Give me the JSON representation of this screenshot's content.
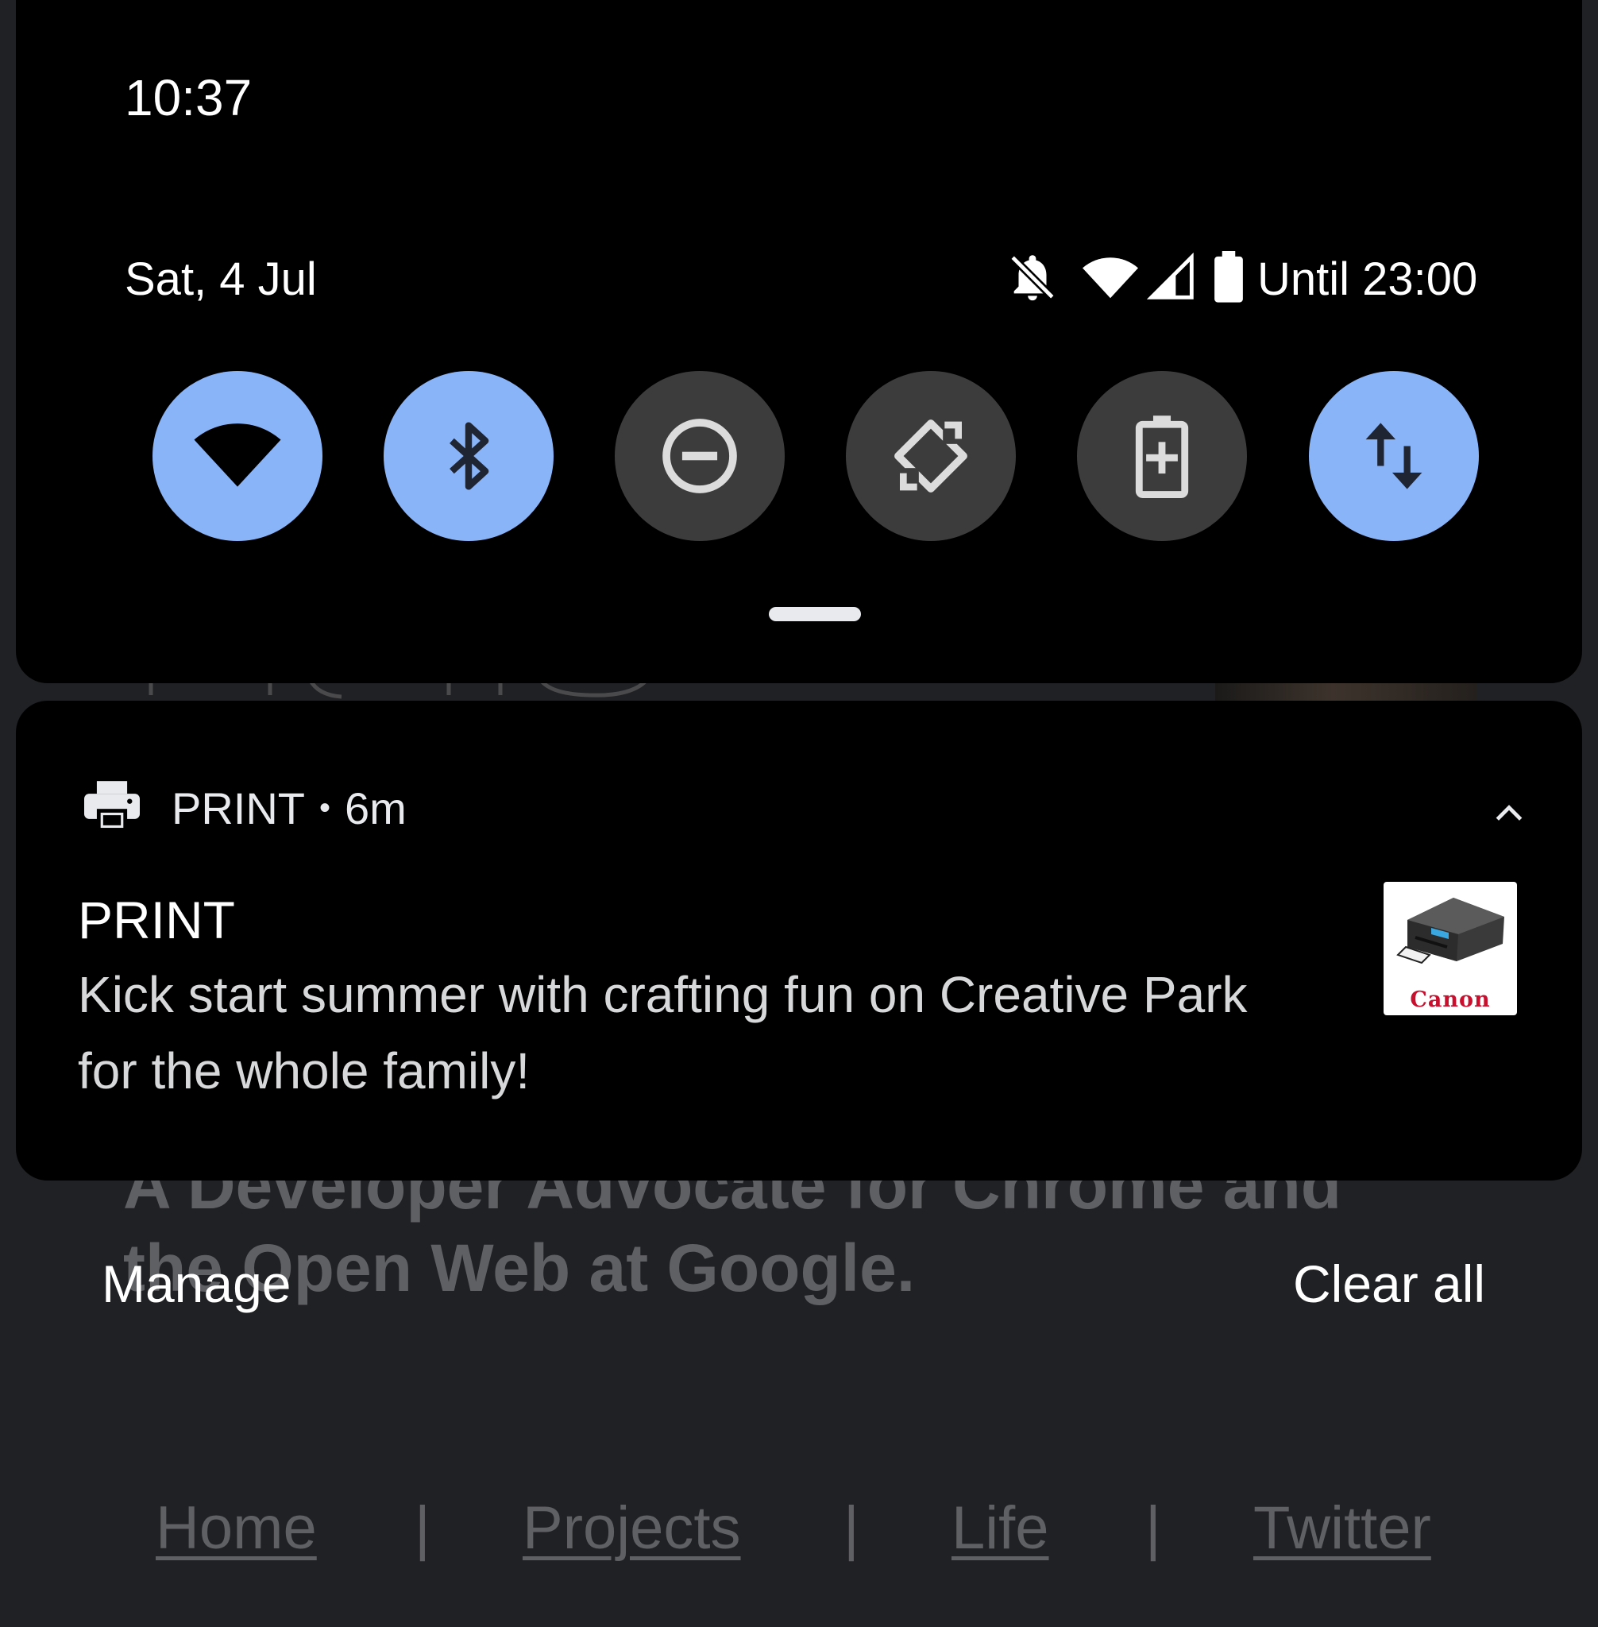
{
  "background_page": {
    "description_lines": [
      "A Developer Advocate for Chrome and",
      "the Open Web at Google."
    ],
    "nav": {
      "links": [
        "Home",
        "Projects",
        "Life",
        "Twitter"
      ],
      "separator": "|"
    }
  },
  "quick_settings": {
    "clock": "10:37",
    "date": "Sat, 4 Jul",
    "status_icons": [
      "notifications-off-icon",
      "wifi-icon",
      "cell-signal-icon",
      "battery-icon"
    ],
    "battery_label": "Until 23:00",
    "tiles": [
      {
        "name": "wifi",
        "icon": "wifi-icon",
        "state": "on"
      },
      {
        "name": "bluetooth",
        "icon": "bluetooth-icon",
        "state": "on"
      },
      {
        "name": "do-not-disturb",
        "icon": "do-not-disturb-icon",
        "state": "off"
      },
      {
        "name": "auto-rotate",
        "icon": "auto-rotate-icon",
        "state": "off"
      },
      {
        "name": "battery-saver",
        "icon": "battery-saver-icon",
        "state": "off"
      },
      {
        "name": "mobile-data",
        "icon": "mobile-data-icon",
        "state": "on"
      }
    ],
    "accent_color": "#8ab4f8",
    "tile_off_color": "#3c3c3c"
  },
  "notification": {
    "app_icon": "printer-icon",
    "app_name": "PRINT",
    "separator": "•",
    "age": "6m",
    "title": "PRINT",
    "body": "Kick start summer with crafting fun on Creative Park for the whole family!",
    "thumbnail_brand": "Canon"
  },
  "footer": {
    "manage_label": "Manage",
    "clear_all_label": "Clear all"
  }
}
